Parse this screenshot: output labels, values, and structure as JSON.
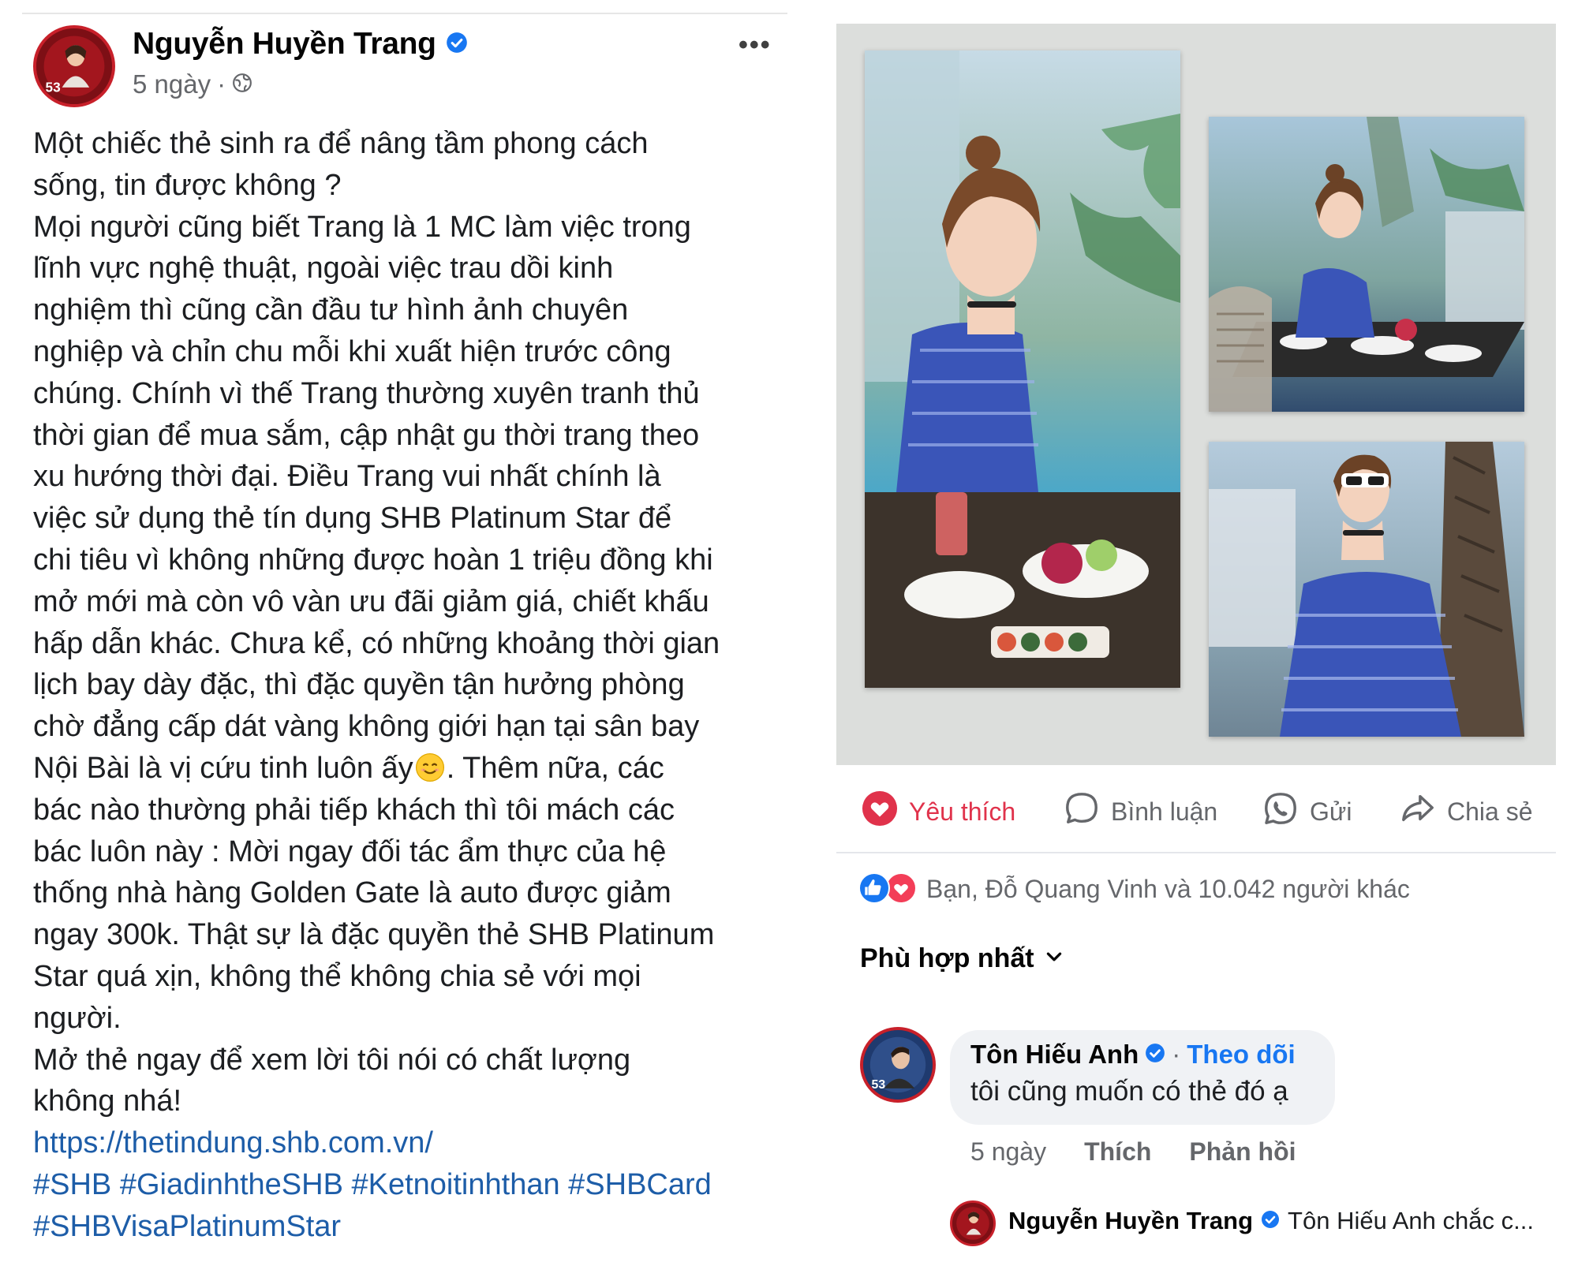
{
  "post": {
    "author": "Nguyễn Huyền Trang",
    "time": "5 ngày",
    "separator": "·",
    "avatar_badge": "53",
    "more": "•••",
    "body_lines": [
      "Một chiếc thẻ sinh ra để nâng tầm phong cách",
      "sống, tin được không ?",
      "Mọi người cũng biết Trang là 1 MC làm việc trong",
      "lĩnh vực nghệ thuật, ngoài việc trau dồi kinh",
      "nghiệm thì cũng cần đầu tư hình ảnh chuyên",
      "nghiệp và chỉn chu mỗi khi xuất hiện trước công",
      "chúng. Chính vì thế Trang thường xuyên tranh thủ",
      "thời gian để mua sắm, cập nhật gu thời trang theo",
      "xu hướng thời đại. Điều Trang vui nhất chính là",
      "việc sử dụng thẻ tín dụng SHB Platinum Star để",
      "chi tiêu vì không những được hoàn 1 triệu đồng khi",
      "mở mới mà còn vô vàn ưu đãi giảm giá, chiết khấu",
      "hấp dẫn khác. Chưa kể, có những khoảng thời gian",
      "lịch bay dày đặc, thì đặc quyền tận hưởng phòng",
      "chờ đẳng cấp dát vàng không giới hạn tại sân bay"
    ],
    "emoji_line_before": "Nội Bài là vị cứu tinh luôn ấy",
    "emoji_line_after": ". Thêm nữa, các",
    "body_lines_2": [
      "bác nào thường phải tiếp khách thì tôi mách các",
      "bác luôn này : Mời ngay đối tác ẩm thực của hệ",
      "thống nhà hàng Golden Gate là auto được giảm",
      "ngay 300k. Thật sự là đặc quyền thẻ SHB Platinum",
      "Star quá xịn, không thể không chia sẻ với mọi",
      "người.",
      "Mở thẻ ngay để xem lời tôi nói có chất lượng",
      "không nhá!"
    ],
    "link": "https://thetindung.shb.com.vn/",
    "hashtags": [
      "#SHB",
      "#GiadinhtheSHB",
      "#Ketnoitinhthan",
      "#SHBCard",
      "#SHBVisaPlatinumStar"
    ]
  },
  "actions": {
    "like": "Yêu thích",
    "comment": "Bình luận",
    "send": "Gửi",
    "share": "Chia sẻ"
  },
  "reactions": {
    "summary": "Bạn, Đỗ Quang Vinh và 10.042 người khác"
  },
  "sort": {
    "label": "Phù hợp nhất"
  },
  "comment": {
    "author": "Tôn Hiếu Anh",
    "separator": "·",
    "follow": "Theo dõi",
    "text": "tôi cũng muốn có thẻ đó ạ",
    "time": "5 ngày",
    "like": "Thích",
    "reply": "Phản hồi"
  },
  "reply": {
    "author": "Nguyễn Huyền Trang",
    "text": "Tôn Hiếu Anh chắc c..."
  },
  "colors": {
    "link": "#1d5da8",
    "liked": "#e0324b",
    "verified": "#1877f2",
    "avatar_ring": "#c8202a"
  }
}
